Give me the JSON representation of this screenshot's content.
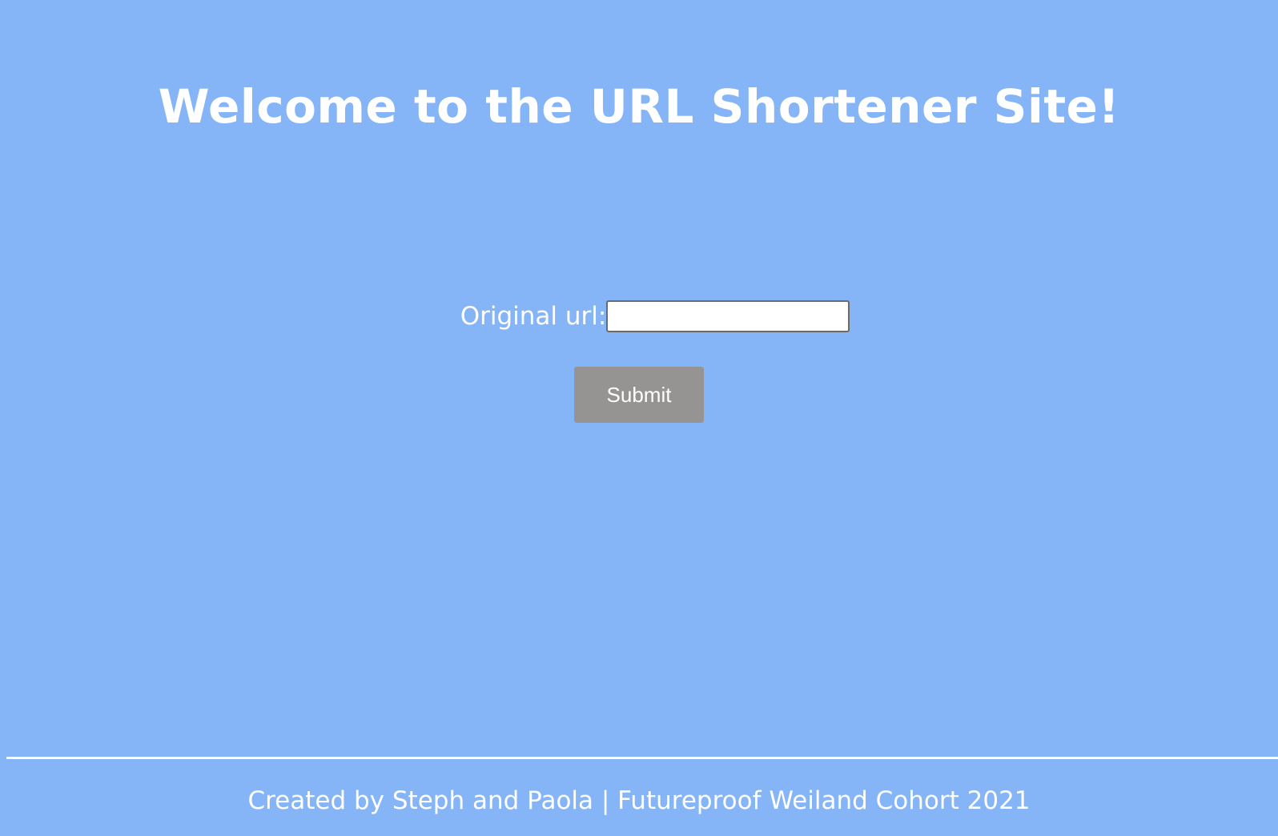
{
  "header": {
    "title": "Welcome to the URL Shortener Site!"
  },
  "form": {
    "url_label": "Original url:",
    "url_value": "",
    "url_placeholder": "",
    "submit_label": "Submit"
  },
  "footer": {
    "credit": "Created by Steph and Paola | Futureproof Weiland Cohort 2021"
  },
  "colors": {
    "background": "#85b5f6",
    "text": "#ffffff",
    "button": "#969393"
  }
}
